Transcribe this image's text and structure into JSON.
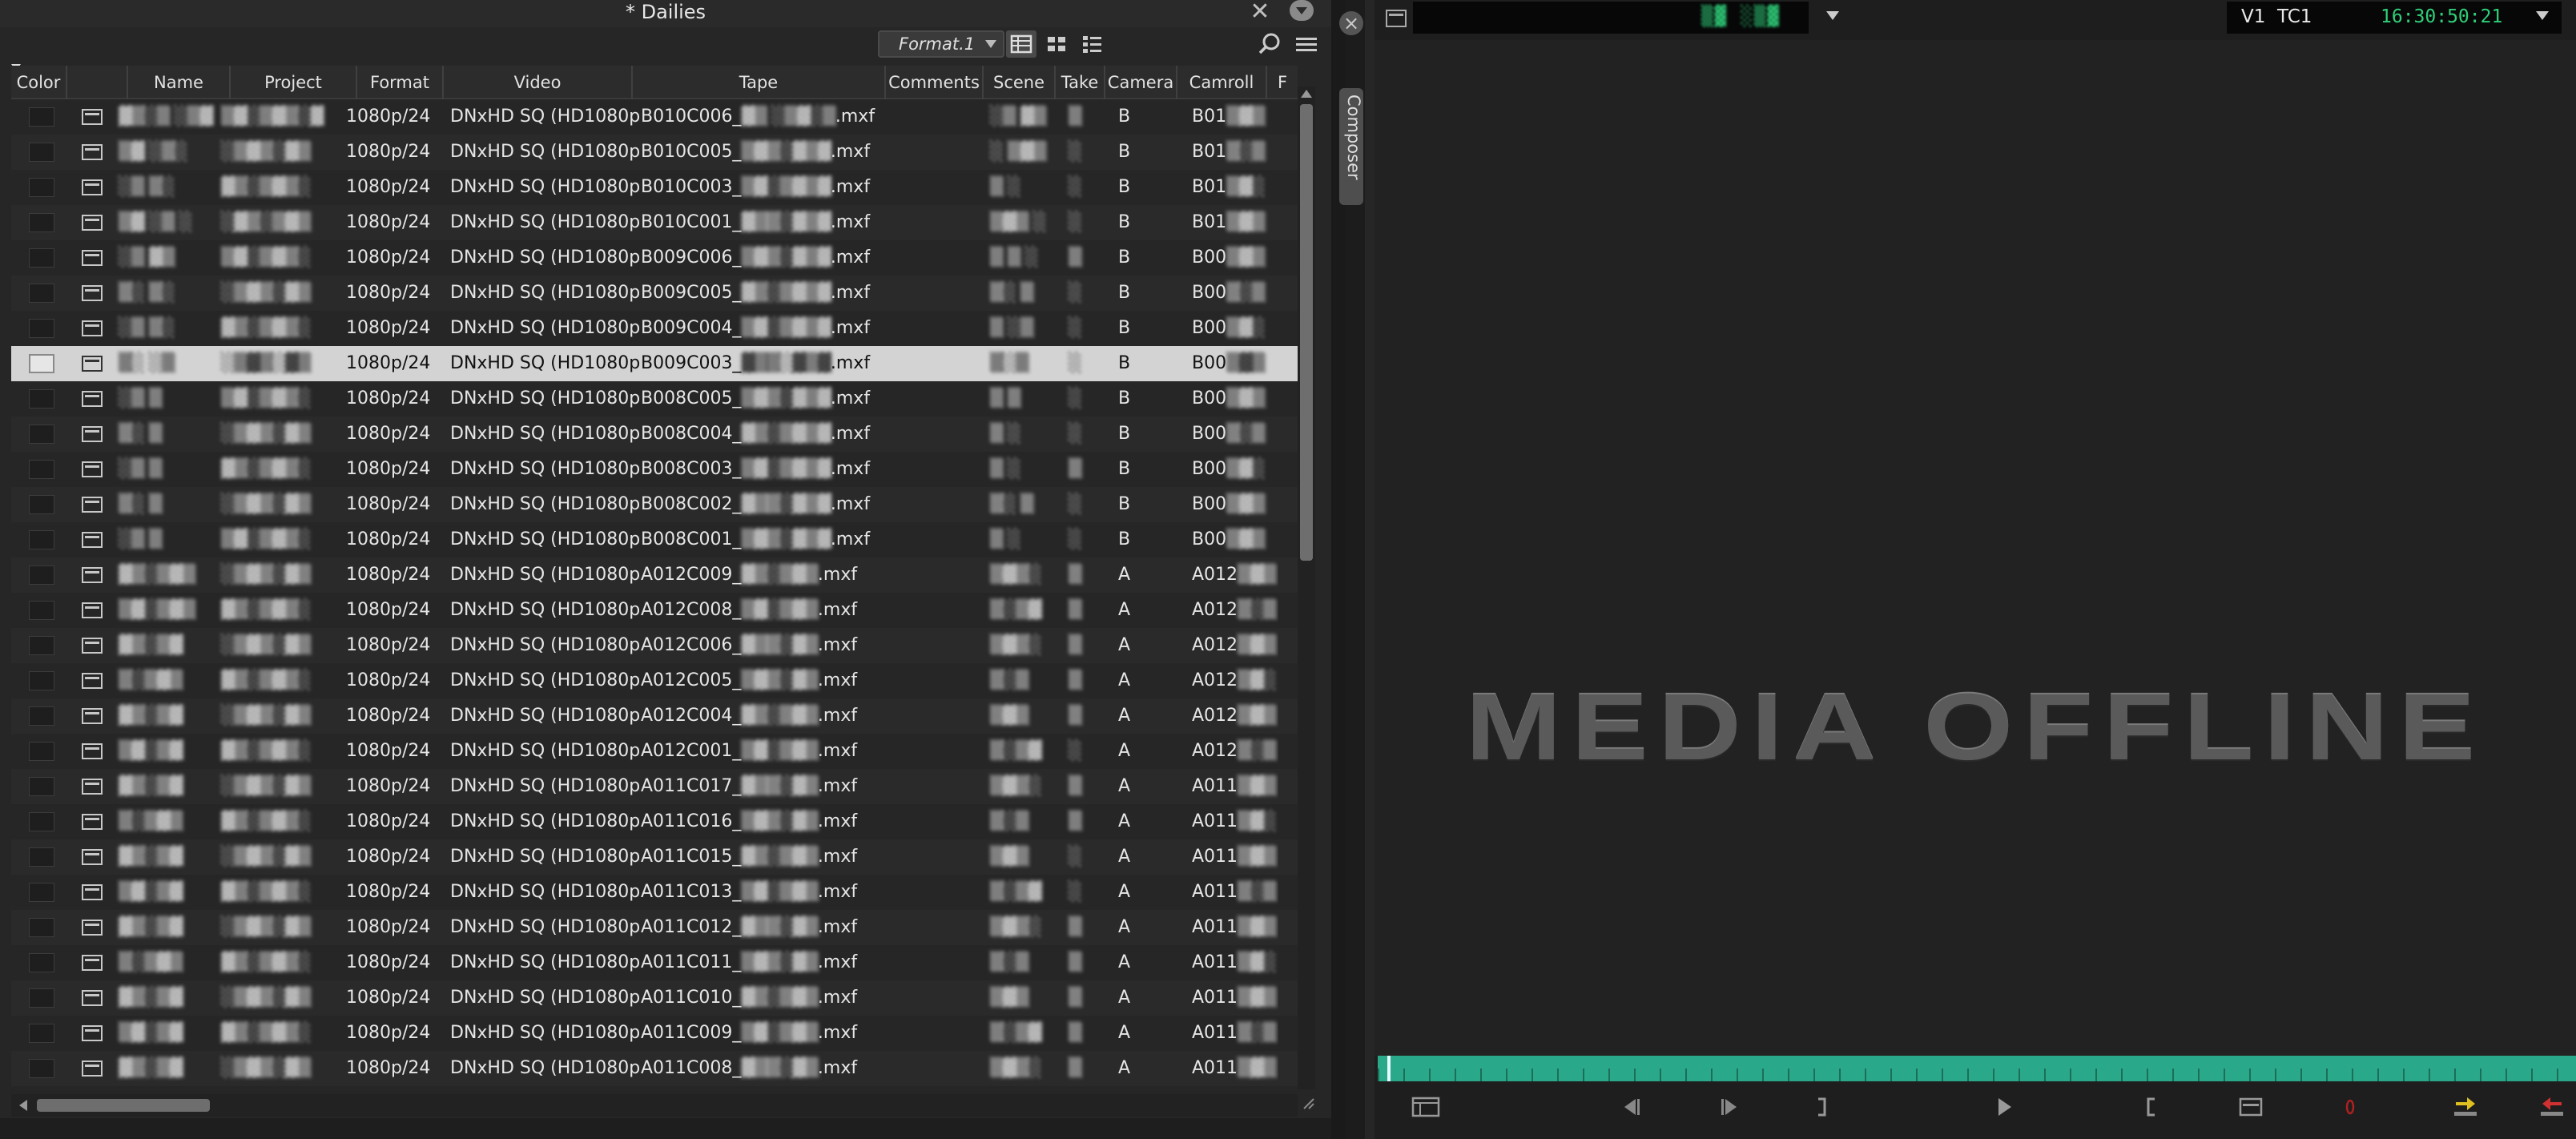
{
  "bin": {
    "title": "* Dailies",
    "close_glyph": "✕",
    "view_name": "Format.1",
    "columns": [
      "Color",
      "",
      "Name",
      "Project",
      "Format",
      "Video",
      "Tape",
      "Comments",
      "Scene",
      "Take",
      "Camera",
      "Camroll",
      "F"
    ],
    "rows": [
      {
        "name": "▓▒░▒ ░▒▓",
        "project": "▒▓░▒▓▒░▓",
        "format": "1080p/24",
        "video": "DNxHD SQ (HD1080p)",
        "tape_prefix": "B010C006_",
        "tape_hidden": "▓▒ ░▒▓░▒",
        "tape_ext": ".mxf",
        "scene": "░▒ ▓▒",
        "take": "▒",
        "camera": "B",
        "camroll_prefix": "B01",
        "camroll_hidden": "▒▓▒"
      },
      {
        "name": "▒▓ ░▒░",
        "project": "░▒▓▒░▓▒",
        "format": "1080p/24",
        "video": "DNxHD SQ (HD1080p)",
        "tape_prefix": "B010C005_",
        "tape_hidden": "▒▓▒░▓▒▓",
        "tape_ext": ".mxf",
        "scene": "░ ▒▓▒",
        "take": "░",
        "camera": "B",
        "camroll_prefix": "B01",
        "camroll_hidden": "▒░▒"
      },
      {
        "name": "░▒ ▒░",
        "project": "▓▒░▒▓▒░",
        "format": "1080p/24",
        "video": "DNxHD SQ (HD1080p)",
        "tape_prefix": "B010C003_",
        "tape_hidden": "▒▓░▒▓▒▓",
        "tape_ext": ".mxf",
        "scene": "▒ ░",
        "take": "░",
        "camera": "B",
        "camroll_prefix": "B01",
        "camroll_hidden": "▒▓░"
      },
      {
        "name": "▒▓ ░▒ ░",
        "project": "░▓▒░▒▓▒",
        "format": "1080p/24",
        "video": "DNxHD SQ (HD1080p)",
        "tape_prefix": "B010C001_",
        "tape_hidden": "▓▒▒░▓▒▓",
        "tape_ext": ".mxf",
        "scene": "▒▓▒ ░",
        "take": "░",
        "camera": "B",
        "camroll_prefix": "B01",
        "camroll_hidden": "▒▓▒"
      },
      {
        "name": "░▒ ▓▒",
        "project": "▒▓░▒▓▒░",
        "format": "1080p/24",
        "video": "DNxHD SQ (HD1080p)",
        "tape_prefix": "B009C006_",
        "tape_hidden": "▒▓▒░▓▒▓",
        "tape_ext": ".mxf",
        "scene": "▒ ▒ ░",
        "take": "▒",
        "camera": "B",
        "camroll_prefix": "B00",
        "camroll_hidden": "▒▓▒"
      },
      {
        "name": "▒░ ▒░",
        "project": "░▒▓▒░▓▒",
        "format": "1080p/24",
        "video": "DNxHD SQ (HD1080p)",
        "tape_prefix": "B009C005_",
        "tape_hidden": "▓▒░▒▓▒▓",
        "tape_ext": ".mxf",
        "scene": "▒░ ▒",
        "take": "░",
        "camera": "B",
        "camroll_prefix": "B00",
        "camroll_hidden": "▒░▒"
      },
      {
        "name": "░▒ ▒░",
        "project": "▓▒░▒▓▒░",
        "format": "1080p/24",
        "video": "DNxHD SQ (HD1080p)",
        "tape_prefix": "B009C004_",
        "tape_hidden": "▒▓░▒▓▒▓",
        "tape_ext": ".mxf",
        "scene": "▒ ░▒",
        "take": "░",
        "camera": "B",
        "camroll_prefix": "B00",
        "camroll_hidden": "▒▓░"
      },
      {
        "name": "▒░ ░▒",
        "project": "░▒▓▒░▓▒",
        "format": "1080p/24",
        "video": "DNxHD SQ (HD1080p)",
        "tape_prefix": "B009C003_",
        "tape_hidden": "▓▒▒░▓▒▓",
        "tape_ext": ".mxf",
        "scene": "▒░▒",
        "take": "░",
        "camera": "B",
        "camroll_prefix": "B00",
        "camroll_hidden": "▒▓▒"
      },
      {
        "name": "░▒ ▒",
        "project": "▒▓░▒▓▒░",
        "format": "1080p/24",
        "video": "DNxHD SQ (HD1080p)",
        "tape_prefix": "B008C005_",
        "tape_hidden": "▒▓▒░▓▒▓",
        "tape_ext": ".mxf",
        "scene": "▒ ▒",
        "take": "░",
        "camera": "B",
        "camroll_prefix": "B00",
        "camroll_hidden": "▒▓▒"
      },
      {
        "name": "▒░ ▒",
        "project": "░▒▓▒░▓▒",
        "format": "1080p/24",
        "video": "DNxHD SQ (HD1080p)",
        "tape_prefix": "B008C004_",
        "tape_hidden": "▓▒░▒▓▒▓",
        "tape_ext": ".mxf",
        "scene": "▒ ░",
        "take": "░",
        "camera": "B",
        "camroll_prefix": "B00",
        "camroll_hidden": "▒░▒"
      },
      {
        "name": "░▒ ▒",
        "project": "▓▒░▒▓▒░",
        "format": "1080p/24",
        "video": "DNxHD SQ (HD1080p)",
        "tape_prefix": "B008C003_",
        "tape_hidden": "▒▓░▒▓▒▓",
        "tape_ext": ".mxf",
        "scene": "▒ ░",
        "take": "▒",
        "camera": "B",
        "camroll_prefix": "B00",
        "camroll_hidden": "▒▓░"
      },
      {
        "name": "▒░ ▒",
        "project": "░▒▓▒░▓▒",
        "format": "1080p/24",
        "video": "DNxHD SQ (HD1080p)",
        "tape_prefix": "B008C002_",
        "tape_hidden": "▓▒▒░▓▒▓",
        "tape_ext": ".mxf",
        "scene": "▒░ ▒",
        "take": "░",
        "camera": "B",
        "camroll_prefix": "B00",
        "camroll_hidden": "▒▓▒"
      },
      {
        "name": "░▒ ▒",
        "project": "▒▓░▒▓▒░",
        "format": "1080p/24",
        "video": "DNxHD SQ (HD1080p)",
        "tape_prefix": "B008C001_",
        "tape_hidden": "▒▓▒░▓▒▓",
        "tape_ext": ".mxf",
        "scene": "▒ ░",
        "take": "░",
        "camera": "B",
        "camroll_prefix": "B00",
        "camroll_hidden": "▒▓▒"
      },
      {
        "name": "▓▒░▒▓▒",
        "project": "░▒▓▒░▓▒",
        "format": "1080p/24",
        "video": "DNxHD SQ (HD1080p)",
        "tape_prefix": "A012C009_",
        "tape_hidden": "▓▒░▒▓▒",
        "tape_ext": ".mxf",
        "scene": "▒▓▒░",
        "take": "▒",
        "camera": "A",
        "camroll_prefix": "A012",
        "camroll_hidden": "▒▓▒"
      },
      {
        "name": "▒▓░▒▓▒",
        "project": "▓▒░▒▓▒░",
        "format": "1080p/24",
        "video": "DNxHD SQ (HD1080p)",
        "tape_prefix": "A012C008_",
        "tape_hidden": "▒▓░▒▓▒",
        "tape_ext": ".mxf",
        "scene": "▒░▒▓",
        "take": "▒",
        "camera": "A",
        "camroll_prefix": "A012",
        "camroll_hidden": "▒░▒"
      },
      {
        "name": "▓▒░▒▓",
        "project": "░▒▓▒░▓▒",
        "format": "1080p/24",
        "video": "DNxHD SQ (HD1080p)",
        "tape_prefix": "A012C006_",
        "tape_hidden": "▓▒▒░▓▒",
        "tape_ext": ".mxf",
        "scene": "▒▓▒░",
        "take": "▒",
        "camera": "A",
        "camroll_prefix": "A012",
        "camroll_hidden": "▒▓▒"
      },
      {
        "name": "▒░▒▓▒",
        "project": "▓▒░▒▓▒░",
        "format": "1080p/24",
        "video": "DNxHD SQ (HD1080p)",
        "tape_prefix": "A012C005_",
        "tape_hidden": "▒▓▒░▓▒",
        "tape_ext": ".mxf",
        "scene": "▒░▒",
        "take": "▒",
        "camera": "A",
        "camroll_prefix": "A012",
        "camroll_hidden": "▒▓░"
      },
      {
        "name": "▓▒░▒▓",
        "project": "░▒▓▒░▓▒",
        "format": "1080p/24",
        "video": "DNxHD SQ (HD1080p)",
        "tape_prefix": "A012C004_",
        "tape_hidden": "▓▒░▒▓▒",
        "tape_ext": ".mxf",
        "scene": "▒▓▒",
        "take": "▒",
        "camera": "A",
        "camroll_prefix": "A012",
        "camroll_hidden": "▒▓▒"
      },
      {
        "name": "▒▓░▒▓",
        "project": "▓▒░▒▓▒░",
        "format": "1080p/24",
        "video": "DNxHD SQ (HD1080p)",
        "tape_prefix": "A012C001_",
        "tape_hidden": "▒▓░▒▓▒",
        "tape_ext": ".mxf",
        "scene": "▒░▒▓",
        "take": "░",
        "camera": "A",
        "camroll_prefix": "A012",
        "camroll_hidden": "▒░▒"
      },
      {
        "name": "▓▒░▒▓",
        "project": "░▒▓▒░▓▒",
        "format": "1080p/24",
        "video": "DNxHD SQ (HD1080p)",
        "tape_prefix": "A011C017_",
        "tape_hidden": "▓▒▒░▓▒",
        "tape_ext": ".mxf",
        "scene": "▒▓▒░",
        "take": "▒",
        "camera": "A",
        "camroll_prefix": "A011",
        "camroll_hidden": "▒▓▒"
      },
      {
        "name": "▒░▒▓▒",
        "project": "▓▒░▒▓▒░",
        "format": "1080p/24",
        "video": "DNxHD SQ (HD1080p)",
        "tape_prefix": "A011C016_",
        "tape_hidden": "▒▓▒░▓▒",
        "tape_ext": ".mxf",
        "scene": "▒░▒",
        "take": "▒",
        "camera": "A",
        "camroll_prefix": "A011",
        "camroll_hidden": "▒▓░"
      },
      {
        "name": "▓▒░▒▓",
        "project": "░▒▓▒░▓▒",
        "format": "1080p/24",
        "video": "DNxHD SQ (HD1080p)",
        "tape_prefix": "A011C015_",
        "tape_hidden": "▓▒░▒▓▒",
        "tape_ext": ".mxf",
        "scene": "▒▓▒",
        "take": "░",
        "camera": "A",
        "camroll_prefix": "A011",
        "camroll_hidden": "▒▓▒"
      },
      {
        "name": "▒▓░▒▓",
        "project": "▓▒░▒▓▒░",
        "format": "1080p/24",
        "video": "DNxHD SQ (HD1080p)",
        "tape_prefix": "A011C013_",
        "tape_hidden": "▒▓░▒▓▒",
        "tape_ext": ".mxf",
        "scene": "▒░▒▓",
        "take": "░",
        "camera": "A",
        "camroll_prefix": "A011",
        "camroll_hidden": "▒░▒"
      },
      {
        "name": "▓▒░▒▓",
        "project": "░▒▓▒░▓▒",
        "format": "1080p/24",
        "video": "DNxHD SQ (HD1080p)",
        "tape_prefix": "A011C012_",
        "tape_hidden": "▓▒▒░▓▒",
        "tape_ext": ".mxf",
        "scene": "▒▓▒░",
        "take": "▒",
        "camera": "A",
        "camroll_prefix": "A011",
        "camroll_hidden": "▒▓▒"
      },
      {
        "name": "▒░▒▓▒",
        "project": "▓▒░▒▓▒░",
        "format": "1080p/24",
        "video": "DNxHD SQ (HD1080p)",
        "tape_prefix": "A011C011_",
        "tape_hidden": "▒▓▒░▓▒",
        "tape_ext": ".mxf",
        "scene": "▒░▒",
        "take": "▒",
        "camera": "A",
        "camroll_prefix": "A011",
        "camroll_hidden": "▒▓░"
      },
      {
        "name": "▓▒░▒▓",
        "project": "░▒▓▒░▓▒",
        "format": "1080p/24",
        "video": "DNxHD SQ (HD1080p)",
        "tape_prefix": "A011C010_",
        "tape_hidden": "▓▒░▒▓▒",
        "tape_ext": ".mxf",
        "scene": "▒▓▒",
        "take": "▒",
        "camera": "A",
        "camroll_prefix": "A011",
        "camroll_hidden": "▒▓▒"
      },
      {
        "name": "▒▓░▒▓",
        "project": "▓▒░▒▓▒░",
        "format": "1080p/24",
        "video": "DNxHD SQ (HD1080p)",
        "tape_prefix": "A011C009_",
        "tape_hidden": "▒▓░▒▓▒",
        "tape_ext": ".mxf",
        "scene": "▒░▒▓",
        "take": "▒",
        "camera": "A",
        "camroll_prefix": "A011",
        "camroll_hidden": "▒░▒"
      },
      {
        "name": "▓▒░▒▓",
        "project": "░▒▓▒░▓▒",
        "format": "1080p/24",
        "video": "DNxHD SQ (HD1080p)",
        "tape_prefix": "A011C008_",
        "tape_hidden": "▓▒▒░▓▒",
        "tape_ext": ".mxf",
        "scene": "▒▓▒░",
        "take": "▒",
        "camera": "A",
        "camroll_prefix": "A011",
        "camroll_hidden": "▒▓▒"
      }
    ],
    "selected_row": 7,
    "selection_color": "#d3d3d3"
  },
  "composer": {
    "tab_label": "Composer",
    "source_timecode": "▒▓ ░▒▓",
    "track": "V1",
    "timecode_track": "TC1",
    "timecode": "16:30:50:21",
    "monitor_message": "MEDIA OFFLINE",
    "timecode_color": "#2fd07a",
    "timeline_color": "#2aa88a",
    "transport_icons": [
      "clip-menu-icon",
      "step-back-icon",
      "step-forward-icon",
      "mark-out-icon",
      "play-icon",
      "mark-in-icon",
      "clear-marks-icon",
      "record-icon",
      "splice-in-icon",
      "lift-icon"
    ]
  }
}
